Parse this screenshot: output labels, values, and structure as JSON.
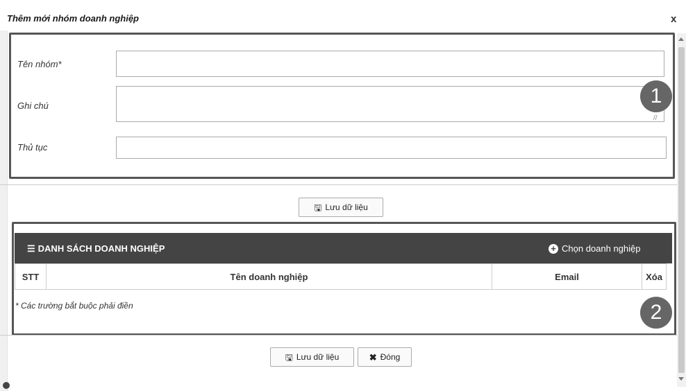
{
  "dialog": {
    "title": "Thêm mới nhóm doanh nghiệp",
    "close": "x"
  },
  "form": {
    "fields": [
      {
        "label": "Tên nhóm*",
        "value": "",
        "placeholder": ""
      },
      {
        "label": "Ghi chú",
        "value": "",
        "placeholder": ""
      },
      {
        "label": "Thủ tục",
        "value": "",
        "placeholder": ""
      }
    ],
    "save_label": "Lưu dữ liệu"
  },
  "list": {
    "title": "DANH SÁCH DOANH NGHIỆP",
    "choose_label": "Chọn doanh nghiệp",
    "columns": [
      "STT",
      "Tên doanh nghiệp",
      "Email",
      "Xóa"
    ],
    "note": "* Các trường bắt buộc phải điền"
  },
  "footer": {
    "save_label": "Lưu dữ liệu",
    "close_label": "Đóng"
  },
  "badges": [
    "1",
    "2"
  ],
  "icons": {
    "save": "floppy-disk-icon",
    "close": "x-icon",
    "list": "list-icon",
    "add": "plus-circle-icon"
  }
}
